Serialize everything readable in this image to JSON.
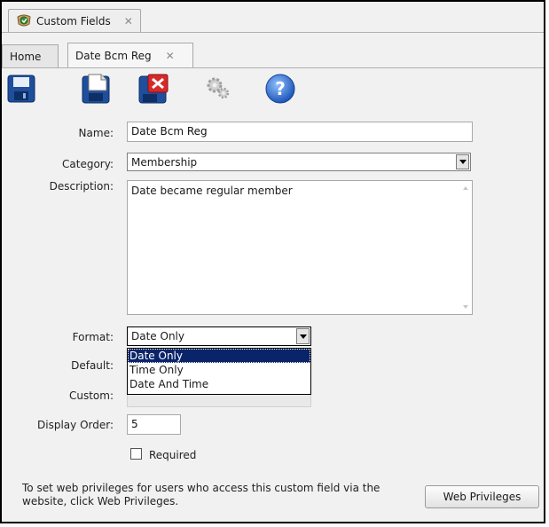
{
  "window": {
    "outer_tab_label": "Custom Fields",
    "inner_tabs": [
      {
        "label": "Home"
      },
      {
        "label": "Date Bcm Reg"
      }
    ]
  },
  "toolbar": {
    "buttons": [
      "save-icon",
      "save-new-icon",
      "delete-icon",
      "settings-icon",
      "help-icon"
    ]
  },
  "form": {
    "name_label": "Name:",
    "name_value": "Date Bcm Reg",
    "category_label": "Category:",
    "category_value": "Membership",
    "description_label": "Description:",
    "description_value": "Date became regular member",
    "format_label": "Format:",
    "format_value": "Date Only",
    "format_options": [
      "Date Only",
      "Time Only",
      "Date And Time"
    ],
    "default_label": "Default:",
    "custom_label": "Custom:",
    "display_order_label": "Display Order:",
    "display_order_value": "5",
    "required_label": "Required"
  },
  "footer": {
    "note_line1": "To set web privileges for users who access this custom field via the",
    "note_line2": "website, click Web Privileges.",
    "web_privileges_label": "Web Privileges"
  },
  "colors": {
    "selection": "#0a246a",
    "help_blue": "#2f6fd1",
    "save_blue": "#1f4e9c",
    "delete_red": "#cc2222"
  }
}
